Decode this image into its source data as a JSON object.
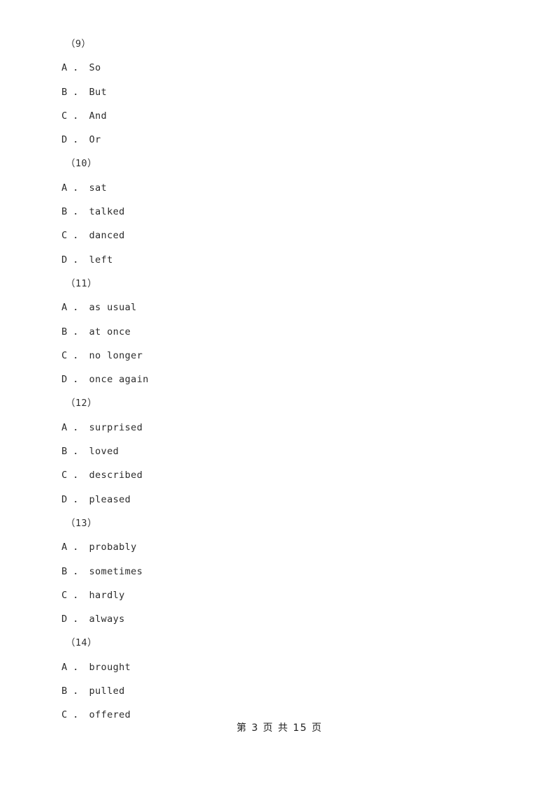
{
  "document": {
    "type": "exam-paper",
    "section": "cloze-test-options",
    "text_color": "#2b2b2b",
    "background_color": "#ffffff"
  },
  "blocks": [
    {
      "kind": "question-number",
      "text": "（9）"
    },
    {
      "kind": "option",
      "text": "A ． So"
    },
    {
      "kind": "option",
      "text": "B ． But"
    },
    {
      "kind": "option",
      "text": "C ． And"
    },
    {
      "kind": "option",
      "text": "D ． Or"
    },
    {
      "kind": "question-number",
      "text": "（10）"
    },
    {
      "kind": "option",
      "text": "A ． sat"
    },
    {
      "kind": "option",
      "text": "B ． talked"
    },
    {
      "kind": "option",
      "text": "C ． danced"
    },
    {
      "kind": "option",
      "text": "D ． left"
    },
    {
      "kind": "question-number",
      "text": "（11）"
    },
    {
      "kind": "option",
      "text": "A ． as usual"
    },
    {
      "kind": "option",
      "text": "B ． at once"
    },
    {
      "kind": "option",
      "text": "C ． no longer"
    },
    {
      "kind": "option",
      "text": "D ． once again"
    },
    {
      "kind": "question-number",
      "text": "（12）"
    },
    {
      "kind": "option",
      "text": "A ． surprised"
    },
    {
      "kind": "option",
      "text": "B ． loved"
    },
    {
      "kind": "option",
      "text": "C ． described"
    },
    {
      "kind": "option",
      "text": "D ． pleased"
    },
    {
      "kind": "question-number",
      "text": "（13）"
    },
    {
      "kind": "option",
      "text": "A ． probably"
    },
    {
      "kind": "option",
      "text": "B ． sometimes"
    },
    {
      "kind": "option",
      "text": "C ． hardly"
    },
    {
      "kind": "option",
      "text": "D ． always"
    },
    {
      "kind": "question-number",
      "text": "（14）"
    },
    {
      "kind": "option",
      "text": "A ． brought"
    },
    {
      "kind": "option",
      "text": "B ． pulled"
    },
    {
      "kind": "option",
      "text": "C ． offered"
    }
  ],
  "footer": {
    "text": "第 3 页 共 15 页",
    "current_page": "3",
    "total_pages": "15"
  }
}
